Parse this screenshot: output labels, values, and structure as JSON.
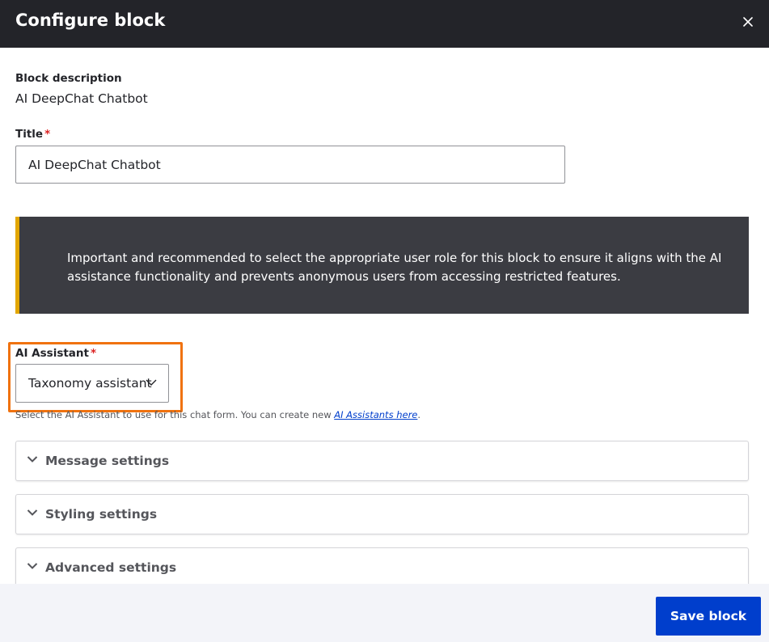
{
  "dialog": {
    "title": "Configure block",
    "close_icon": "close-icon"
  },
  "block_description": {
    "label": "Block description",
    "value": "AI DeepChat Chatbot"
  },
  "title_field": {
    "label": "Title",
    "required_mark": "*",
    "value": "AI DeepChat Chatbot"
  },
  "notice": {
    "text": "Important and recommended to select the appropriate user role for this block to ensure it aligns with the AI assistance functionality and prevents anonymous users from accessing restricted features."
  },
  "ai_assistant": {
    "label": "AI Assistant",
    "required_mark": "*",
    "selected": "Taxonomy assistant",
    "help_text": "Select the AI Assistant to use for this chat form. You can create new ",
    "help_link": "AI Assistants here",
    "help_suffix": "."
  },
  "sections": [
    {
      "label": "Message settings"
    },
    {
      "label": "Styling settings"
    },
    {
      "label": "Advanced settings"
    }
  ],
  "footer": {
    "save_label": "Save block"
  },
  "colors": {
    "header_bg": "#232429",
    "notice_bg": "#3b3c42",
    "notice_accent": "#e2a600",
    "highlight": "#f0720f",
    "primary": "#003ecc",
    "required": "#dc2323"
  }
}
